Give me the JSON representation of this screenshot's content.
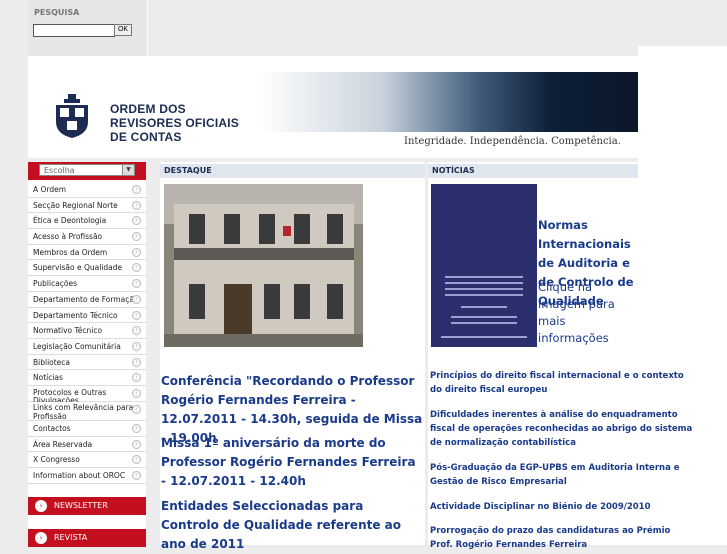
{
  "search": {
    "label": "PESQUISA",
    "value": "",
    "button": "OK"
  },
  "header": {
    "org_line1": "ORDEM DOS",
    "org_line2": "REVISORES OFICIAIS",
    "org_line3": "DE CONTAS",
    "tagline": "Integridade. Independência. Competência."
  },
  "sidebar": {
    "select_value": "Escolha",
    "items": [
      "A Ordem",
      "Secção Regional Norte",
      "Ética e Deontologia",
      "Acesso à Profissão",
      "Membros da Ordem",
      "Supervisão e Qualidade",
      "Publicações",
      "Departamento de Formação",
      "Departamento Técnico",
      "Normativo Técnico",
      "Legislação Comunitária",
      "Biblioteca",
      "Notícias",
      "Protocolos e Outras Divulgações",
      "Links com Relevância para a Profissão",
      "Contactos",
      "Área Reservada",
      "X Congresso",
      "Information about OROC"
    ],
    "newsletter": "NEWSLETTER",
    "revista": "REVISTA"
  },
  "destaque": {
    "header": "DESTAQUE",
    "links": [
      "Conferência \"Recordando o Professor Rogério Fernandes Ferreira - 12.07.2011 - 14.30h, seguida de Missa - 19.00h",
      "Missa 1º aniversário da morte do Professor Rogério Fernandes Ferreira - 12.07.2011 - 12.40h",
      "Entidades Seleccionadas para Controlo de Qualidade referente ao ano de 2011"
    ]
  },
  "noticias": {
    "header": "NOTÍCIAS",
    "book_title": "Normas Internacionais de Auditoria e de Controlo de Qualidade",
    "book_sub": "Clique na imagem para mais informações",
    "links": [
      "Princípios do direito fiscal internacional e o contexto do direito fiscal europeu",
      "Dificuldades inerentes à análise do enquadramento fiscal de operações reconhecidas ao abrigo do sistema de normalização contabilística",
      "Pós-Graduação da EGP-UPBS em Auditoria Interna e Gestão de Risco Empresarial",
      "Actividade Disciplinar no Biénio de 2009/2010",
      "Prorrogação do prazo das candidaturas ao Prémio Prof. Rogério Fernandes Ferreira"
    ]
  },
  "colors": {
    "accent_red": "#c4101e",
    "link_blue": "#1a3a8a",
    "navy": "#1c2c53"
  }
}
